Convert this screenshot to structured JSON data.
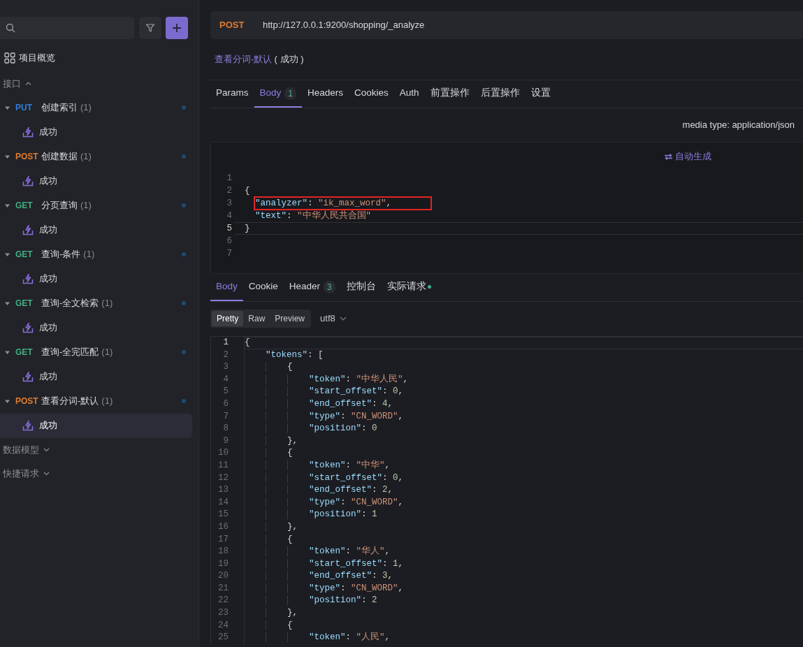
{
  "sidebar": {
    "overview": "项目概览",
    "sections": [
      {
        "label": "接口",
        "expanded": true,
        "requests": [
          {
            "method": "PUT",
            "name": "创建索引",
            "count": "(1)",
            "expanded": true,
            "children": [
              {
                "label": "成功",
                "selected": false
              }
            ]
          },
          {
            "method": "POST",
            "name": "创建数据",
            "count": "(1)",
            "expanded": true,
            "children": [
              {
                "label": "成功",
                "selected": false
              }
            ]
          },
          {
            "method": "GET",
            "name": "分页查询",
            "count": "(1)",
            "expanded": true,
            "children": [
              {
                "label": "成功",
                "selected": false
              }
            ]
          },
          {
            "method": "GET",
            "name": "查询-条件",
            "count": "(1)",
            "expanded": true,
            "children": [
              {
                "label": "成功",
                "selected": false
              }
            ]
          },
          {
            "method": "GET",
            "name": "查询-全文检索",
            "count": "(1)",
            "expanded": true,
            "children": [
              {
                "label": "成功",
                "selected": false
              }
            ]
          },
          {
            "method": "GET",
            "name": "查询-全完匹配",
            "count": "(1)",
            "expanded": true,
            "children": [
              {
                "label": "成功",
                "selected": false
              }
            ]
          },
          {
            "method": "POST",
            "name": "查看分词-默认",
            "count": "(1)",
            "expanded": true,
            "children": [
              {
                "label": "成功",
                "selected": true
              }
            ]
          }
        ]
      },
      {
        "label": "数据模型",
        "expanded": false
      },
      {
        "label": "快捷请求",
        "expanded": false
      }
    ]
  },
  "request": {
    "method": "POST",
    "url": "http://127.0.0.1:9200/shopping/_analyze",
    "name": "查看分词-默认",
    "status": "( 成功 )",
    "tabs": [
      {
        "label": "Params",
        "selected": false
      },
      {
        "label": "Body",
        "badge": "1",
        "selected": true
      },
      {
        "label": "Headers",
        "selected": false
      },
      {
        "label": "Cookies",
        "selected": false
      },
      {
        "label": "Auth",
        "selected": false
      },
      {
        "label": "前置操作",
        "selected": false
      },
      {
        "label": "后置操作",
        "selected": false
      },
      {
        "label": "设置",
        "selected": false
      }
    ],
    "media_type": "media type: application/json",
    "generate": "自动生成",
    "body_lines": [
      {
        "number": "1",
        "current": false,
        "boxed": false
      },
      {
        "number": "2",
        "code": "{",
        "current": false,
        "boxed": false
      },
      {
        "number": "3",
        "code": "  \"analyzer\": \"ik_max_word\",",
        "current": false,
        "boxed": true
      },
      {
        "number": "4",
        "code": "  \"text\": \"中华人民共合国\"",
        "current": false,
        "boxed": false
      },
      {
        "number": "5",
        "code": "}",
        "current": true,
        "boxed": false
      },
      {
        "number": "6",
        "current": false,
        "boxed": false
      },
      {
        "number": "7",
        "current": false,
        "boxed": false
      }
    ]
  },
  "response": {
    "tabs": [
      {
        "label": "Body",
        "selected": true
      },
      {
        "label": "Cookie",
        "selected": false
      },
      {
        "label": "Header",
        "badge": "3",
        "selected": false
      },
      {
        "label": "控制台",
        "selected": false
      },
      {
        "label": "实际请求",
        "dot": true,
        "selected": false
      }
    ],
    "formats": [
      {
        "label": "Pretty",
        "selected": true
      },
      {
        "label": "Raw",
        "selected": false
      },
      {
        "label": "Preview",
        "selected": false
      }
    ],
    "encoding": "utf8",
    "lines": [
      {
        "number": "1",
        "code": "{",
        "current": true
      },
      {
        "number": "2",
        "code": "    \"tokens\": [",
        "current": false
      },
      {
        "number": "3",
        "code": "        {",
        "current": false
      },
      {
        "number": "4",
        "code": "            \"token\": \"中华人民\",",
        "current": false
      },
      {
        "number": "5",
        "code": "            \"start_offset\": 0,",
        "current": false
      },
      {
        "number": "6",
        "code": "            \"end_offset\": 4,",
        "current": false
      },
      {
        "number": "7",
        "code": "            \"type\": \"CN_WORD\",",
        "current": false
      },
      {
        "number": "8",
        "code": "            \"position\": 0",
        "current": false
      },
      {
        "number": "9",
        "code": "        },",
        "current": false
      },
      {
        "number": "10",
        "code": "        {",
        "current": false
      },
      {
        "number": "11",
        "code": "            \"token\": \"中华\",",
        "current": false
      },
      {
        "number": "12",
        "code": "            \"start_offset\": 0,",
        "current": false
      },
      {
        "number": "13",
        "code": "            \"end_offset\": 2,",
        "current": false
      },
      {
        "number": "14",
        "code": "            \"type\": \"CN_WORD\",",
        "current": false
      },
      {
        "number": "15",
        "code": "            \"position\": 1",
        "current": false
      },
      {
        "number": "16",
        "code": "        },",
        "current": false
      },
      {
        "number": "17",
        "code": "        {",
        "current": false
      },
      {
        "number": "18",
        "code": "            \"token\": \"华人\",",
        "current": false
      },
      {
        "number": "19",
        "code": "            \"start_offset\": 1,",
        "current": false
      },
      {
        "number": "20",
        "code": "            \"end_offset\": 3,",
        "current": false
      },
      {
        "number": "21",
        "code": "            \"type\": \"CN_WORD\",",
        "current": false
      },
      {
        "number": "22",
        "code": "            \"position\": 2",
        "current": false
      },
      {
        "number": "23",
        "code": "        },",
        "current": false
      },
      {
        "number": "24",
        "code": "        {",
        "current": false
      },
      {
        "number": "25",
        "code": "            \"token\": \"人民\",",
        "current": false
      }
    ]
  }
}
